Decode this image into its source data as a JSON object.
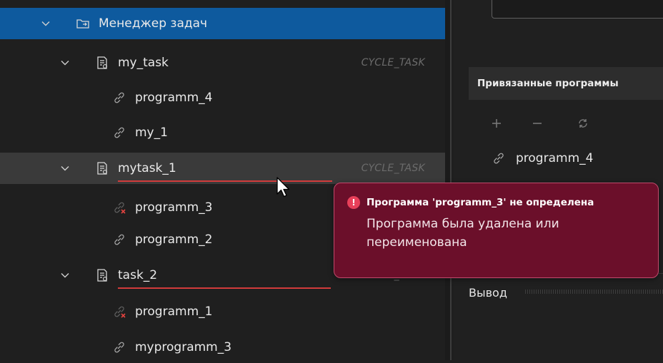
{
  "tree": {
    "items": [
      {
        "label": "Менеджер задач",
        "icon": "folder-sync-icon",
        "level": 0,
        "expanded": true,
        "selected": true
      },
      {
        "label": "my_task",
        "icon": "task-file-icon",
        "level": 1,
        "expanded": true,
        "tag": "CYCLE_TASK"
      },
      {
        "label": "programm_4",
        "icon": "link-icon",
        "level": 2
      },
      {
        "label": "my_1",
        "icon": "link-icon",
        "level": 2
      },
      {
        "label": "mytask_1",
        "icon": "task-file-icon",
        "level": 1,
        "expanded": true,
        "tag": "CYCLE_TASK",
        "error": true,
        "hover": true
      },
      {
        "label": "programm_3",
        "icon": "broken-link-icon",
        "level": 2,
        "broken": true
      },
      {
        "label": "programm_2",
        "icon": "link-icon",
        "level": 2
      },
      {
        "label": "task_2",
        "icon": "task-file-icon",
        "level": 1,
        "expanded": true,
        "tag": "CYCLE_TASK",
        "error": true
      },
      {
        "label": "programm_1",
        "icon": "broken-link-icon",
        "level": 2,
        "broken": true
      },
      {
        "label": "myprogramm_3",
        "icon": "link-icon",
        "level": 2
      }
    ]
  },
  "right_panel": {
    "bound_programs_title": "Привязанные программы",
    "toolbar": [
      "add-icon",
      "remove-icon",
      "refresh-icon"
    ],
    "bound_items": [
      "programm_4"
    ],
    "output_label": "Вывод"
  },
  "toast": {
    "title": "Программа 'programm_3' не определена",
    "message": "Программа была удалена или переименована",
    "severity": "error"
  },
  "colors": {
    "selected_row": "#0e5a9e",
    "hover_row": "#3a3a3a",
    "error_underline": "#d23b3b",
    "toast_bg": "#6b0f2a",
    "toast_border": "#c14a6c"
  }
}
